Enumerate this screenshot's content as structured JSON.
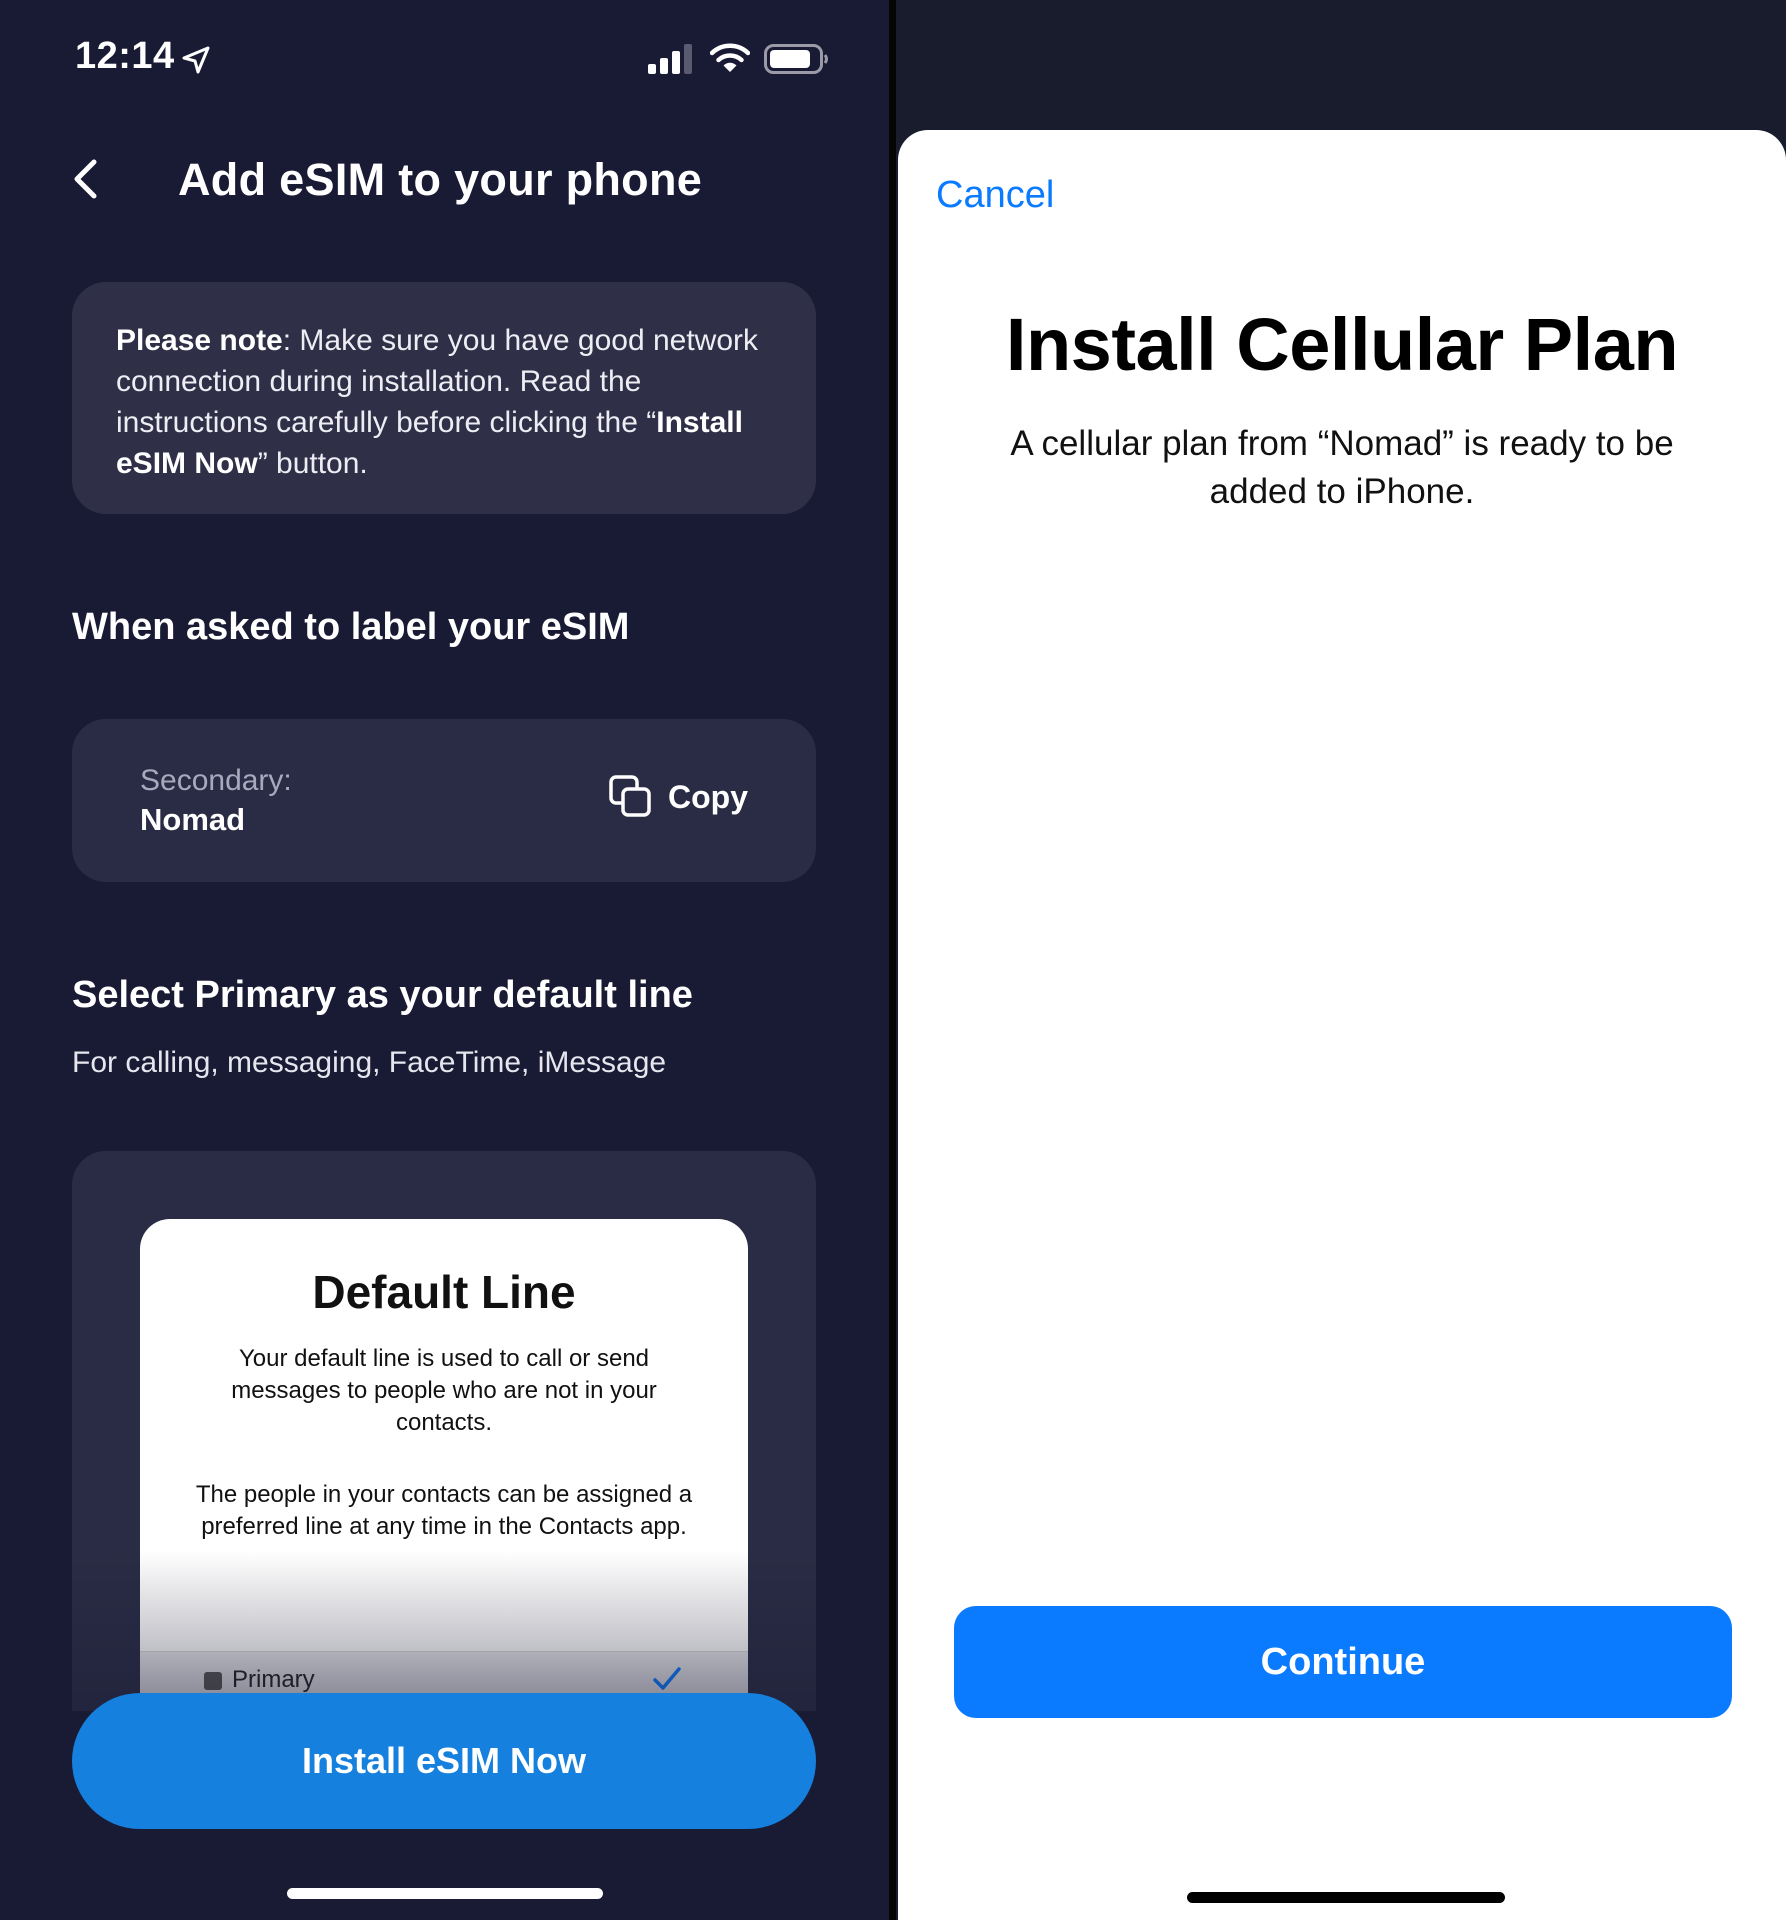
{
  "status_bar": {
    "time": "12:14"
  },
  "header": {
    "title": "Add eSIM to your phone"
  },
  "note": {
    "bold_lead": "Please note",
    "text_1": ": Make sure you have good network connection during installation. Read the instructions carefully before clicking the “",
    "bold_button": "Install eSIM Now",
    "text_2": "” button."
  },
  "label_section": {
    "title": "When asked to label your eSIM",
    "key": "Secondary:",
    "value": "Nomad",
    "copy_label": "Copy"
  },
  "default_section": {
    "title": "Select Primary as your default line",
    "subtitle": "For calling, messaging, FaceTime, iMessage"
  },
  "preview": {
    "title": "Default Line",
    "para_1": "Your default line is used to call or send messages to people who are not in your contacts.",
    "para_2": "The people in your contacts can be assigned a preferred line at any time in the Contacts app.",
    "row_label": "Primary"
  },
  "install_button": "Install eSIM Now",
  "sheet": {
    "cancel": "Cancel",
    "title": "Install Cellular Plan",
    "description": "A cellular plan from “Nomad” is ready to be added to iPhone.",
    "continue": "Continue"
  },
  "colors": {
    "left_bg": "#191a33",
    "card_bg": "#2f3048",
    "install_blue": "#1580dd",
    "ios_blue": "#0a7aff"
  }
}
